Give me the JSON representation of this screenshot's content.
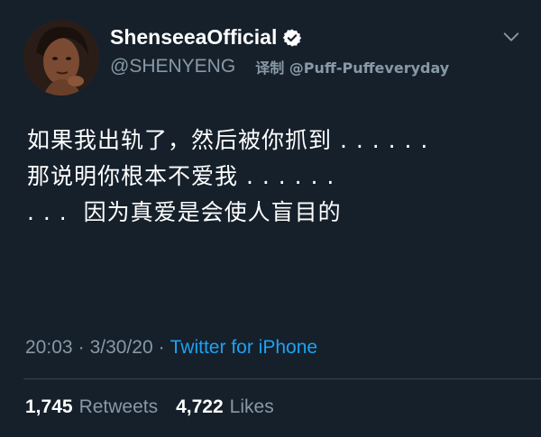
{
  "author": {
    "display_name": "ShenseeaOfficial",
    "handle": "@SHENYENG",
    "avatar_icon": "profile-photo",
    "verified_icon": "verified-badge-icon"
  },
  "translator_credit": "译制 @Puff-Puffeveryday",
  "tweet_lines": [
    "如果我出轨了，然后被你抓到 . . . . . .",
    "那说明你根本不爱我 . . . . . .",
    ". . .  因为真爱是会使人盲目的"
  ],
  "meta": {
    "time": "20:03",
    "date": "3/30/20",
    "separator": "·",
    "source": "Twitter for iPhone"
  },
  "stats": {
    "retweets_count": "1,745",
    "retweets_label": "Retweets",
    "likes_count": "4,722",
    "likes_label": "Likes"
  },
  "colors": {
    "background": "#15202b",
    "secondary_text": "#8899a6",
    "link": "#1da1f2",
    "verified": "#ffffff"
  }
}
